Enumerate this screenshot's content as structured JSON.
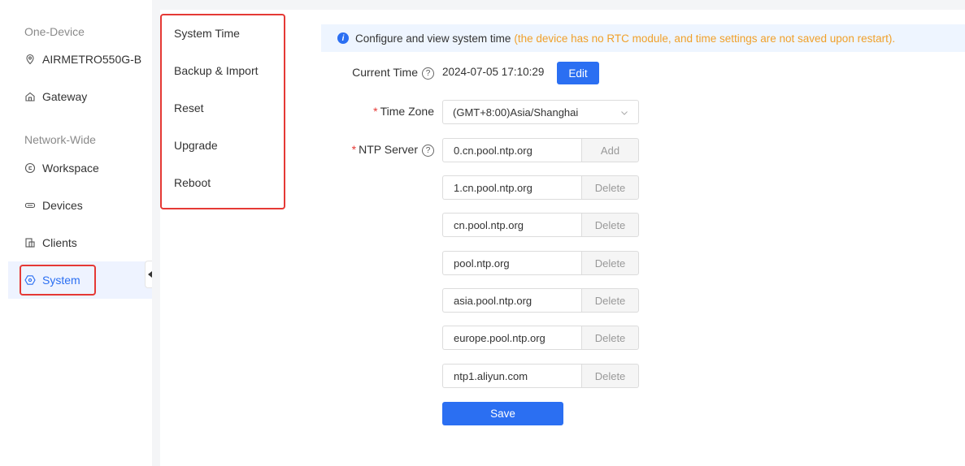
{
  "nav": {
    "group_device": "One-Device",
    "device_name": "AIRMETRO550G-B",
    "gateway": "Gateway",
    "group_network": "Network-Wide",
    "workspace": "Workspace",
    "devices": "Devices",
    "clients": "Clients",
    "system": "System"
  },
  "submenu": [
    "System Time",
    "Backup & Import",
    "Reset",
    "Upgrade",
    "Reboot"
  ],
  "banner": {
    "text": "Configure and view system time",
    "note": "(the device has no RTC module, and time settings are not saved upon restart)."
  },
  "form": {
    "current_time_label": "Current Time",
    "current_time_value": "2024-07-05 17:10:29",
    "edit_label": "Edit",
    "time_zone_label": "Time Zone",
    "time_zone_value": "(GMT+8:00)Asia/Shanghai",
    "ntp_label": "NTP Server",
    "ntp_servers": [
      {
        "value": "0.cn.pool.ntp.org",
        "action": "Add"
      },
      {
        "value": "1.cn.pool.ntp.org",
        "action": "Delete"
      },
      {
        "value": "cn.pool.ntp.org",
        "action": "Delete"
      },
      {
        "value": "pool.ntp.org",
        "action": "Delete"
      },
      {
        "value": "asia.pool.ntp.org",
        "action": "Delete"
      },
      {
        "value": "europe.pool.ntp.org",
        "action": "Delete"
      },
      {
        "value": "ntp1.aliyun.com",
        "action": "Delete"
      }
    ],
    "save_label": "Save"
  },
  "colors": {
    "accent": "#2b6ff2",
    "highlight": "#e53935",
    "note": "#f0a02a"
  }
}
